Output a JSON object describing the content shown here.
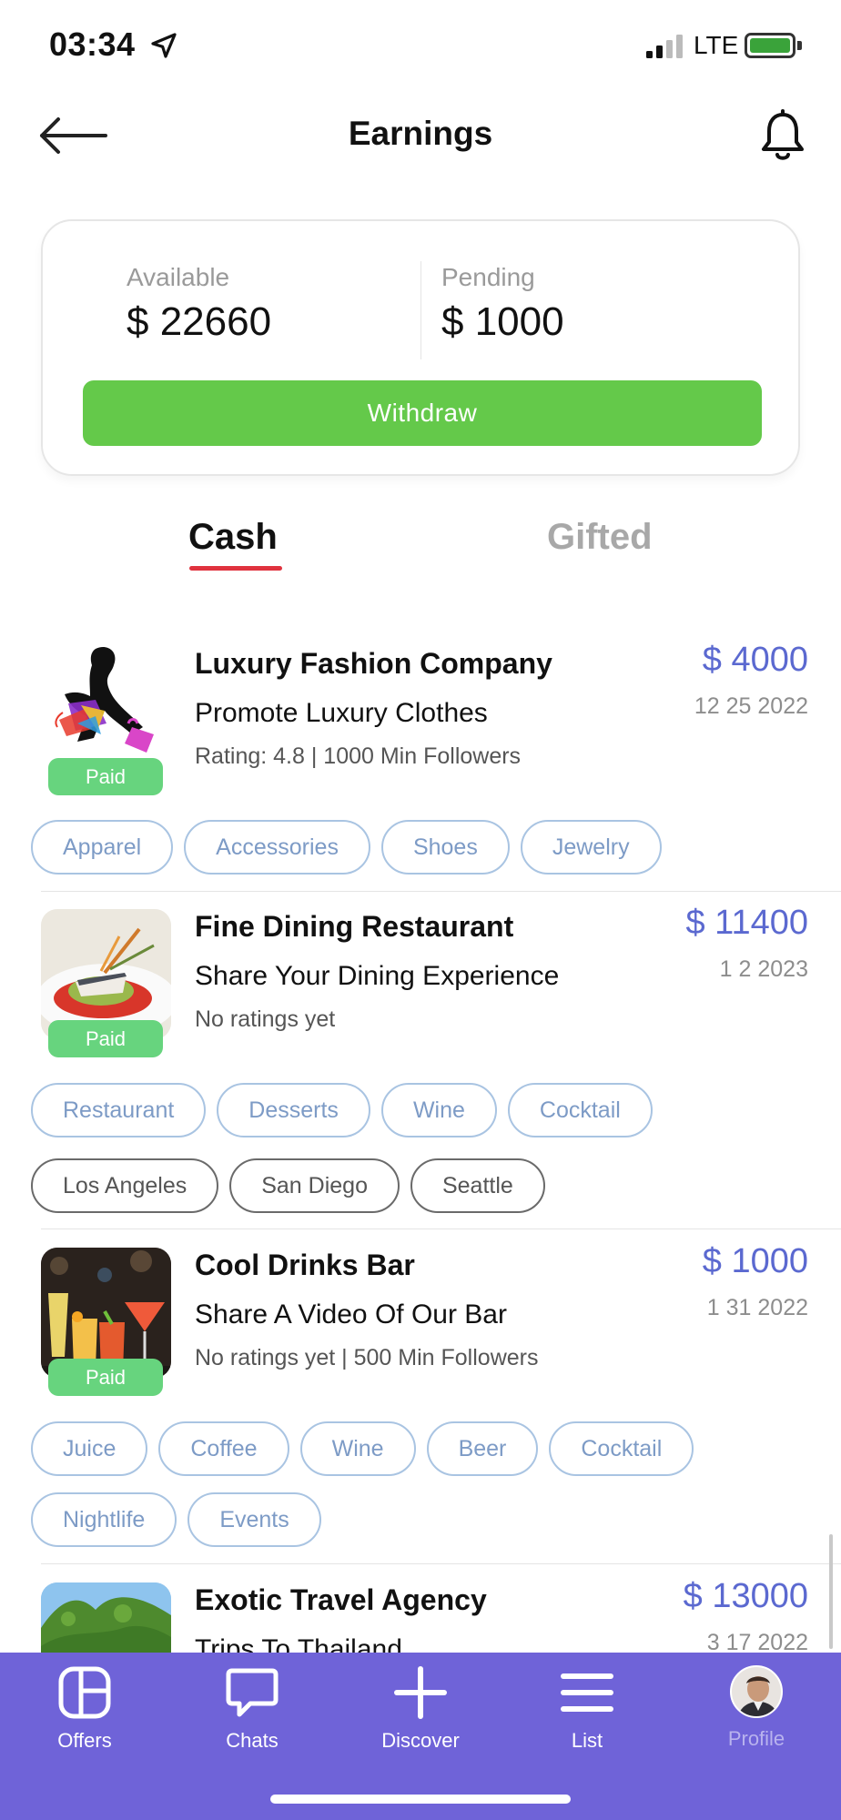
{
  "status_bar": {
    "time": "03:34",
    "network": "LTE",
    "location_icon": "location-arrow-icon",
    "battery_color": "#3aa33a"
  },
  "header": {
    "title": "Earnings",
    "back_icon": "arrow-left-icon",
    "bell_icon": "bell-icon"
  },
  "balance": {
    "available_label": "Available",
    "available_value": "$ 22660",
    "pending_label": "Pending",
    "pending_value": "$ 1000",
    "withdraw_label": "Withdraw"
  },
  "tabs": [
    {
      "label": "Cash",
      "selected": true
    },
    {
      "label": "Gifted",
      "selected": false
    }
  ],
  "offers": [
    {
      "title": "Luxury Fashion Company",
      "subtitle": "Promote Luxury Clothes",
      "meta": "Rating: 4.8 | 1000 Min Followers",
      "amount": "$  4000",
      "date": "12 25 2022",
      "badge": "Paid",
      "tags": [
        "Apparel",
        "Accessories",
        "Shoes",
        "Jewelry"
      ],
      "locations": []
    },
    {
      "title": "Fine Dining Restaurant",
      "subtitle": "Share Your Dining Experience",
      "meta": "No ratings yet",
      "amount": "$  11400",
      "date": "1 2 2023",
      "badge": "Paid",
      "tags": [
        "Restaurant",
        "Desserts",
        "Wine",
        "Cocktail"
      ],
      "locations": [
        "Los Angeles",
        "San Diego",
        "Seattle"
      ]
    },
    {
      "title": "Cool Drinks Bar",
      "subtitle": "Share A Video Of Our Bar",
      "meta": "No ratings yet | 500 Min Followers",
      "amount": "$  1000",
      "date": "1 31 2022",
      "badge": "Paid",
      "tags": [
        "Juice",
        "Coffee",
        "Wine",
        "Beer",
        "Cocktail"
      ],
      "tags2": [
        "Nightlife",
        "Events"
      ],
      "locations": []
    },
    {
      "title": "Exotic Travel Agency",
      "subtitle": "Trips To Thailand",
      "meta": "",
      "amount": "$  13000",
      "date": "3 17 2022",
      "badge": "",
      "tags": [],
      "locations": []
    }
  ],
  "nav": {
    "color": "#6f63d8",
    "items": [
      {
        "label": "Offers",
        "icon": "offers-grid-icon"
      },
      {
        "label": "Chats",
        "icon": "chat-bubble-icon"
      },
      {
        "label": "Discover",
        "icon": "plus-icon"
      },
      {
        "label": "List",
        "icon": "menu-lines-icon"
      },
      {
        "label": "Profile",
        "icon": "avatar"
      }
    ]
  }
}
